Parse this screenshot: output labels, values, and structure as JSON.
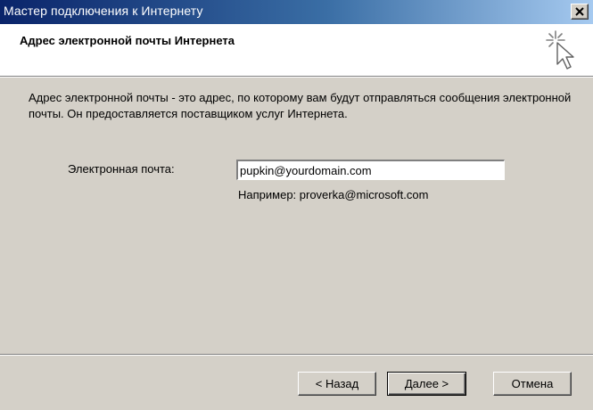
{
  "window": {
    "title": "Мастер подключения к Интернету",
    "close_icon": "close-icon"
  },
  "header": {
    "title": "Адрес электронной почты Интернета",
    "icon": "wizard-cursor-icon"
  },
  "body": {
    "description": "Адрес электронной почты - это адрес, по которому вам будут отправляться сообщения электронной почты. Он предоставляется поставщиком услуг Интернета.",
    "email_label": "Электронная почта:",
    "email_value": "pupkin@yourdomain.com",
    "email_example": "Например: proverka@microsoft.com"
  },
  "buttons": {
    "back_label": "< Назад",
    "next_label": "Далее >",
    "cancel_label": "Отмена"
  }
}
